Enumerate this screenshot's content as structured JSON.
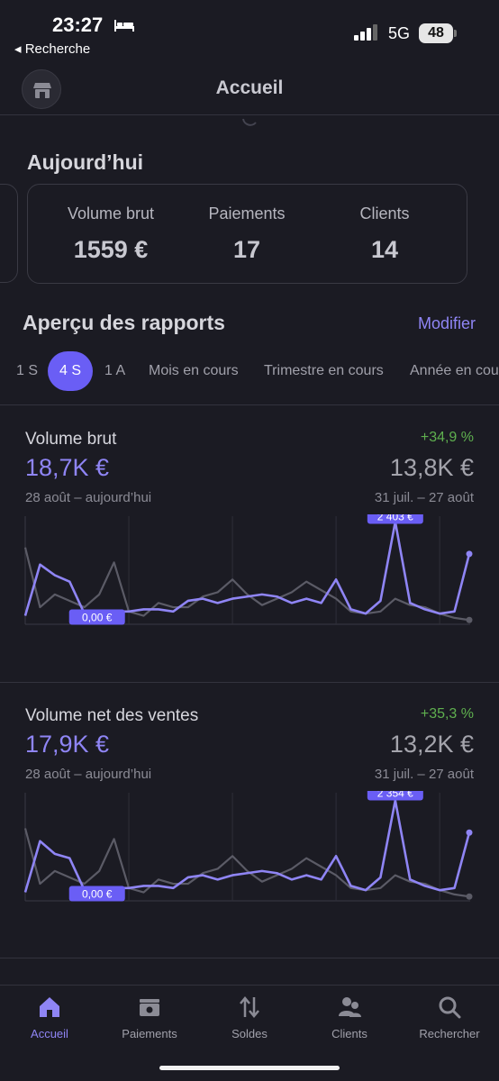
{
  "status_bar": {
    "time": "23:27",
    "back_label": "◂ Recherche",
    "network": "5G",
    "battery": "48"
  },
  "nav": {
    "title": "Accueil"
  },
  "today": {
    "title": "Aujourd’hui",
    "metrics": [
      {
        "label": "Volume brut",
        "value": "1559 €"
      },
      {
        "label": "Paiements",
        "value": "17"
      },
      {
        "label": "Clients",
        "value": "14"
      }
    ]
  },
  "reports": {
    "title": "Aperçu des rapports",
    "modify_label": "Modifier",
    "periods": [
      "1 S",
      "4 S",
      "1 A",
      "Mois en cours",
      "Trimestre en cours",
      "Année en cou"
    ],
    "active_period": "4 S",
    "cards": [
      {
        "label": "Volume brut",
        "change": "+34,9 %",
        "current": "18,7K €",
        "previous": "13,8K €",
        "current_period": "28 août – aujourd’hui",
        "previous_period": "31 juil. – 27 août",
        "max_label": "2 403 €",
        "min_label": "0,00 €"
      },
      {
        "label": "Volume net des ventes",
        "change": "+35,3 %",
        "current": "17,9K €",
        "previous": "13,2K €",
        "current_period": "28 août – aujourd’hui",
        "previous_period": "31 juil. – 27 août",
        "max_label": "2 354 €",
        "min_label": "0,00 €"
      }
    ]
  },
  "tab_bar": {
    "items": [
      {
        "label": "Accueil",
        "icon": "home-icon",
        "active": true
      },
      {
        "label": "Paiements",
        "icon": "payments-icon"
      },
      {
        "label": "Soldes",
        "icon": "balances-icon"
      },
      {
        "label": "Clients",
        "icon": "clients-icon"
      },
      {
        "label": "Rechercher",
        "icon": "search-icon"
      }
    ]
  },
  "colors": {
    "accent": "#8f85f5",
    "accent_strong": "#6a5ef5",
    "positive": "#5fb04f",
    "background": "#1b1b23",
    "previous_series": "#5b5b66"
  },
  "chart_data": [
    {
      "type": "line",
      "x_start": "28 août",
      "series": [
        {
          "values": [
            200,
            1400,
            1150,
            1000,
            250,
            300,
            300,
            300,
            350,
            350,
            300,
            550,
            600,
            500,
            600,
            650,
            700,
            650,
            500,
            600,
            500,
            1050,
            350,
            250,
            550,
            2403,
            500,
            350,
            250,
            300,
            1650
          ]
        },
        {
          "values": [
            1800,
            400,
            700,
            550,
            400,
            700,
            1450,
            300,
            200,
            500,
            400,
            400,
            650,
            750,
            1050,
            700,
            450,
            600,
            750,
            1000,
            800,
            600,
            300,
            250,
            300,
            600,
            450,
            400,
            250,
            150,
            100
          ]
        }
      ],
      "annotations": [
        {
          "label": "2 403 €"
        },
        {
          "label": "0,00 €"
        }
      ]
    },
    {
      "type": "line",
      "x_start": "28 août",
      "series": [
        {
          "values": [
            200,
            1400,
            1100,
            1000,
            250,
            300,
            300,
            300,
            350,
            350,
            300,
            550,
            600,
            500,
            600,
            650,
            700,
            650,
            500,
            600,
            500,
            1050,
            350,
            250,
            550,
            2354,
            500,
            350,
            250,
            300,
            1600
          ]
        },
        {
          "values": [
            1700,
            400,
            700,
            550,
            400,
            700,
            1450,
            300,
            200,
            500,
            400,
            400,
            650,
            750,
            1050,
            700,
            450,
            600,
            750,
            1000,
            800,
            600,
            300,
            250,
            300,
            600,
            450,
            400,
            250,
            150,
            100
          ]
        }
      ],
      "annotations": [
        {
          "label": "2 354 €"
        },
        {
          "label": "0,00 €"
        }
      ]
    }
  ]
}
